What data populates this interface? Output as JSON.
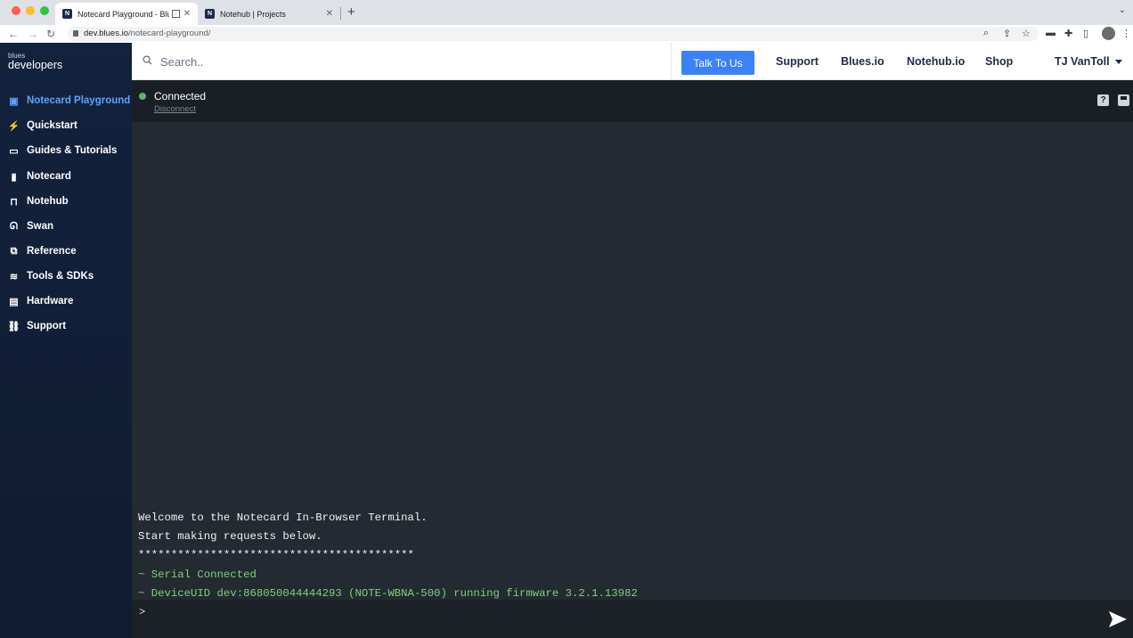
{
  "browser": {
    "tabs": [
      {
        "title": "Notecard Playground - Blu",
        "active": true
      },
      {
        "title": "Notehub | Projects",
        "active": false
      }
    ],
    "new_tab": "+",
    "url_host": "dev.blues.io",
    "url_path": "/notecard-playground/"
  },
  "brand": {
    "small": "blues",
    "big": "developers"
  },
  "sidebar": {
    "items": [
      {
        "label": "Notecard Playground",
        "icon": "terminal-icon",
        "active": true
      },
      {
        "label": "Quickstart",
        "icon": "lightning-icon"
      },
      {
        "label": "Guides & Tutorials",
        "icon": "monitor-icon"
      },
      {
        "label": "Notecard",
        "icon": "notecard-icon"
      },
      {
        "label": "Notehub",
        "icon": "hub-icon"
      },
      {
        "label": "Swan",
        "icon": "swan-icon"
      },
      {
        "label": "Reference",
        "icon": "code-icon"
      },
      {
        "label": "Tools & SDKs",
        "icon": "layers-icon"
      },
      {
        "label": "Hardware",
        "icon": "hardware-icon"
      },
      {
        "label": "Support",
        "icon": "support-icon"
      }
    ]
  },
  "header": {
    "search_placeholder": "Search..",
    "talk_button": "Talk To Us",
    "links": [
      "Support",
      "Blues.io",
      "Notehub.io",
      "Shop"
    ],
    "user": "TJ VanToll"
  },
  "status": {
    "connected": "Connected",
    "disconnect": "Disconnect",
    "help": "?"
  },
  "terminal": {
    "lines": [
      {
        "text": "Welcome to the Notecard In-Browser Terminal.",
        "color": "white"
      },
      {
        "text": "Start making requests below.",
        "color": "white"
      },
      {
        "text": "******************************************",
        "color": "white"
      },
      {
        "text": "~ Serial Connected",
        "color": "green"
      },
      {
        "text": "~ DeviceUID dev:868050044444293 (NOTE-WBNA-500) running firmware 3.2.1.13982",
        "color": "green"
      }
    ],
    "prompt": ">",
    "input_value": ""
  },
  "colors": {
    "accent": "#3b82f6",
    "sidebar_active": "#5ea3ff",
    "connected_dot": "#5bb56a",
    "terminal_green": "#7fcf7a"
  }
}
